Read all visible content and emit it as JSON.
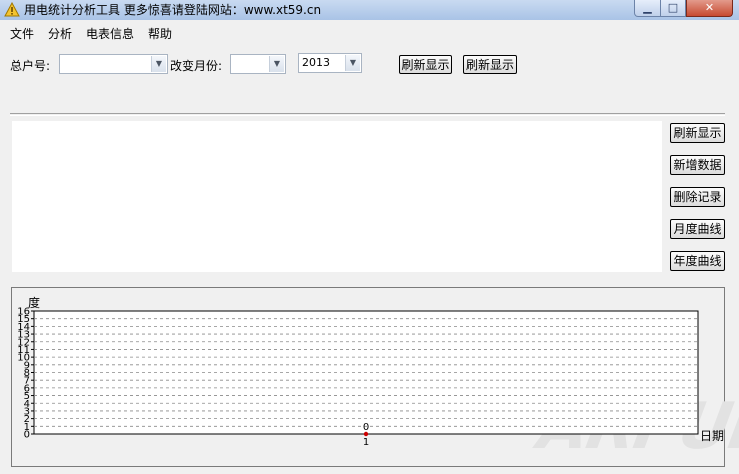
{
  "window": {
    "title": "用电统计分析工具   更多惊喜请登陆网站：www.xt59.cn",
    "min_symbol": "▁",
    "max_symbol": "□",
    "close_symbol": "✕"
  },
  "menu": {
    "items": [
      "文件",
      "分析",
      "电表信息",
      "帮助"
    ]
  },
  "toolbar": {
    "account_label": "总户号:",
    "account_value": "",
    "change_month_label": "改变月份:",
    "month_value": "",
    "year_value": "2013",
    "refresh_button_1": "刷新显示",
    "refresh_button_2": "刷新显示"
  },
  "side_buttons": {
    "refresh": "刷新显示",
    "add_data": "新增数据",
    "delete_record": "删除记录",
    "monthly_curve": "月度曲线",
    "yearly_curve": "年度曲线"
  },
  "chart_data": {
    "type": "scatter",
    "ylabel": "度",
    "xlabel": "日期",
    "ylim": [
      0,
      16
    ],
    "y_ticks": [
      0,
      1,
      2,
      3,
      4,
      5,
      6,
      7,
      8,
      9,
      10,
      11,
      12,
      13,
      14,
      15,
      16
    ],
    "grid": "horizontal-dashed",
    "series": [
      {
        "color": "#cc0000",
        "points": [
          {
            "x": 1,
            "y": 0,
            "label": "0"
          }
        ]
      }
    ],
    "x_tick_labels": [
      "1"
    ]
  },
  "watermark": {
    "text": "ARPUN"
  },
  "colors": {
    "titlebar_top": "#c9daf1",
    "titlebar_bottom": "#a9c3e6",
    "window_bg": "#f0f0f0",
    "point": "#cc0000"
  }
}
